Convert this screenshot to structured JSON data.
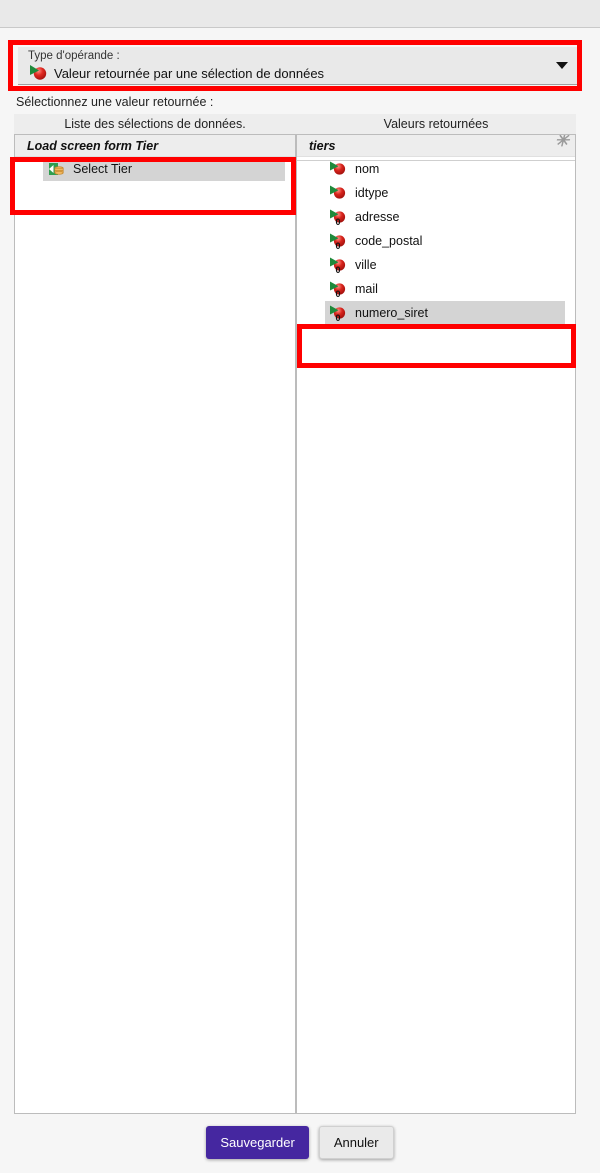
{
  "window": {
    "title_bar_empty": true
  },
  "operand": {
    "label": "Type d'opérande :",
    "value": "Valeur retournée par une sélection de données",
    "icon": "data-selection-icon",
    "arrow_icon": "chevron-down-icon"
  },
  "instruction": "Sélectionnez une valeur retournée :",
  "columns": {
    "left": "Liste des sélections de données.",
    "right": "Valeurs retournées"
  },
  "left_panel": {
    "search": {
      "value": "",
      "placeholder": "",
      "icon": "search-icon"
    },
    "groups": [
      {
        "label": "Load screen form Tier",
        "items": [
          {
            "label": "Select Tier",
            "icon": "data-selection-db-icon",
            "selected": true,
            "badge": ""
          }
        ]
      }
    ]
  },
  "right_panel": {
    "search": {
      "value": "",
      "placeholder": "",
      "icon": "search-icon"
    },
    "asterisk_icon": "asterisk-icon",
    "groups": [
      {
        "label": "tiers",
        "items": [
          {
            "label": "nom",
            "icon": "returned-value-icon",
            "selected": false,
            "badge": ""
          },
          {
            "label": "idtype",
            "icon": "returned-value-icon",
            "selected": false,
            "badge": ""
          },
          {
            "label": "adresse",
            "icon": "returned-value-zero-icon",
            "selected": false,
            "badge": "0"
          },
          {
            "label": "code_postal",
            "icon": "returned-value-zero-icon",
            "selected": false,
            "badge": "0"
          },
          {
            "label": "ville",
            "icon": "returned-value-zero-icon",
            "selected": false,
            "badge": "0"
          },
          {
            "label": "mail",
            "icon": "returned-value-zero-icon",
            "selected": false,
            "badge": "0"
          },
          {
            "label": "numero_siret",
            "icon": "returned-value-zero-icon",
            "selected": true,
            "badge": "0"
          }
        ]
      }
    ]
  },
  "footer": {
    "save_label": "Sauvegarder",
    "cancel_label": "Annuler"
  },
  "colors": {
    "accent": "#4527a0",
    "highlight_box": "#ff0000",
    "selection": "#d4d4d4",
    "panel_bg": "#ffffff",
    "window_bg": "#f6f6f6",
    "icon_red": "#cc1111",
    "icon_green": "#1f8a3b",
    "icon_db_orange": "#e8a33d"
  }
}
